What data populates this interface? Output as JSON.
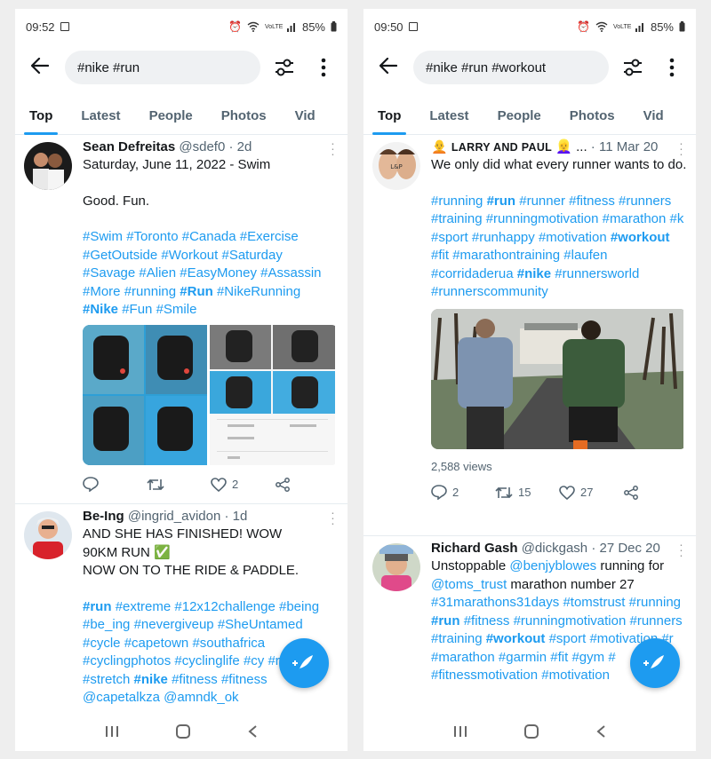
{
  "left": {
    "status": {
      "time": "09:52",
      "battery": "85%",
      "lte": "VoLTE"
    },
    "search": {
      "query": "#nike #run"
    },
    "tabs": [
      "Top",
      "Latest",
      "People",
      "Photos",
      "Vid"
    ],
    "tweets": [
      {
        "name": "Sean Defreitas",
        "handle": "@sdef0",
        "time": "· 2d",
        "line1": "Saturday, June 11, 2022 - Swim",
        "line2": "Good. Fun.",
        "tags": [
          "#Swim",
          "#Toronto",
          "#Canada",
          "#Exercise",
          "#GetOutside",
          "#Workout",
          "#Saturday",
          "#Savage",
          "#Alien",
          "#EasyMoney",
          "#Assassin",
          "#More",
          "#running",
          "#Run",
          "#NikeRunning",
          "#Nike",
          "#Fun",
          "#Smile"
        ],
        "reply_count": "",
        "retweet_count": "",
        "like_count": "2"
      },
      {
        "name": "Be-Ing",
        "handle": "@ingrid_avidon",
        "time": "· 1d",
        "line1": "AND SHE HAS FINISHED! WOW",
        "line2": "90KM RUN ✅",
        "line3": "NOW ON TO THE RIDE & PADDLE.",
        "tags": [
          "#run",
          "#extreme",
          "#12x12challenge",
          "#being",
          "#be_ing",
          "#nevergiveup",
          "#SheUntamed",
          "#cycle",
          "#capetown",
          "#southafrica",
          "#cyclingphotos",
          "#cyclinglife",
          "#cy",
          "#running",
          "#stretch",
          "#nike",
          "#fitness",
          "#fitness"
        ],
        "mentions": "@capetalkza @amndk_ok"
      }
    ]
  },
  "right": {
    "status": {
      "time": "09:50",
      "battery": "85%",
      "lte": "VoLTE"
    },
    "search": {
      "query": "#nike #run #workout"
    },
    "tabs": [
      "Top",
      "Latest",
      "People",
      "Photos",
      "Vid"
    ],
    "tweets": [
      {
        "name_emoji": "🧑‍🦲",
        "name": "LARRY AND PAUL",
        "name_suffix": "👱‍♀️ ...",
        "time": "· 11 Mar 20",
        "line1": "We only did what every runner wants to do.",
        "tags": [
          "#running",
          "#run",
          "#runner",
          "#fitness",
          "#runners",
          "#training",
          "#runningmotivation",
          "#marathon",
          "#k",
          "#sport",
          "#runhappy",
          "#motivation",
          "#workout",
          "#fit",
          "#marathontraining",
          "#laufen",
          "#corridaderua",
          "#nike",
          "#runnersworld",
          "#runnerscommunity"
        ],
        "views": "2,588 views",
        "reply_count": "2",
        "retweet_count": "15",
        "like_count": "27"
      },
      {
        "name": "Richard Gash",
        "handle": "@dickgash",
        "time": "· 27 Dec 20",
        "line1": "Unstoppable",
        "mention1": "@benjyblowes",
        "line1b": "running for",
        "mention2": "@toms_trust",
        "line2": "marathon number 27",
        "tags": [
          "#31marathons31days",
          "#tomstrust",
          "#running",
          "#run",
          "#fitness",
          "#runningmotivation",
          "#runners",
          "#training",
          "#workout",
          "#sport",
          "#motivation",
          "#r",
          "#marathon",
          "#garmin",
          "#fit",
          "#gym",
          "#",
          "#fitnessmotivation",
          "#motivation"
        ]
      }
    ]
  },
  "colors": {
    "accent": "#1d9bf0",
    "text": "#14171a",
    "muted": "#536471"
  }
}
